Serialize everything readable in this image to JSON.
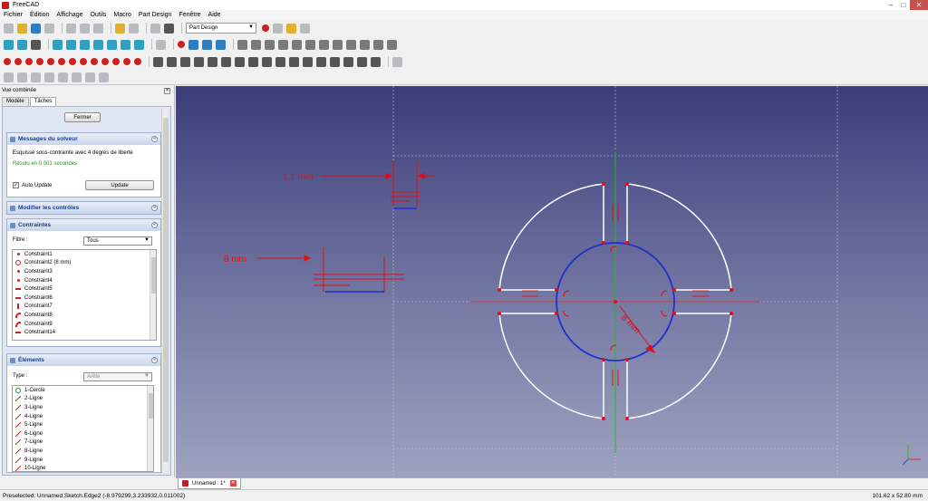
{
  "window": {
    "title": "FreeCAD"
  },
  "menu": [
    "Fichier",
    "Édition",
    "Affichage",
    "Outils",
    "Macro",
    "Part Design",
    "Fenêtre",
    "Aide"
  ],
  "toolbar": {
    "workbench": "Part Design"
  },
  "combo_view": {
    "title": "Vue combinée",
    "tabs": [
      "Modèle",
      "Tâches"
    ],
    "close_button": "Fermer",
    "solver": {
      "title": "Messages du solveur",
      "message": "Esquisse sous-contrainte avec 4 degrés de liberté",
      "status": "Résolu en 0.001 secondes",
      "auto_update_label": "Auto Update",
      "auto_update_checked": true,
      "update_button": "Update"
    },
    "controls": {
      "title": "Modifier les contrôles"
    },
    "constraints": {
      "title": "Contraintes",
      "filter_label": "Filtre :",
      "filter_value": "Tous",
      "items": [
        {
          "label": "Constraint1",
          "icon": "point-on-object-icon"
        },
        {
          "label": "Constraint2 (8 mm)",
          "icon": "radius-icon"
        },
        {
          "label": "Constraint3",
          "icon": "point-on-object-icon"
        },
        {
          "label": "Constraint4",
          "icon": "point-on-object-icon"
        },
        {
          "label": "Constraint5",
          "icon": "horizontal-icon"
        },
        {
          "label": "Constraint6",
          "icon": "horizontal-icon"
        },
        {
          "label": "Constraint7",
          "icon": "vertical-icon"
        },
        {
          "label": "Constraint8",
          "icon": "tangent-icon"
        },
        {
          "label": "Constraint9",
          "icon": "tangent-icon"
        },
        {
          "label": "Constraint14",
          "icon": "horizontal-icon"
        }
      ]
    },
    "elements": {
      "title": "Éléments",
      "type_label": "Type :",
      "type_value": "Arête",
      "items": [
        {
          "label": "1-Cercle",
          "icon": "circle-icon"
        },
        {
          "label": "2-Ligne",
          "icon": "line-icon"
        },
        {
          "label": "3-Ligne",
          "icon": "line-icon"
        },
        {
          "label": "4-Ligne",
          "icon": "line-icon"
        },
        {
          "label": "5-Ligne",
          "icon": "line-icon"
        },
        {
          "label": "6-Ligne",
          "icon": "line-icon"
        },
        {
          "label": "7-Ligne",
          "icon": "line-icon"
        },
        {
          "label": "8-Ligne",
          "icon": "line-icon"
        },
        {
          "label": "9-Ligne",
          "icon": "line-icon"
        },
        {
          "label": "10-Ligne",
          "icon": "line-icon"
        }
      ]
    }
  },
  "sketch": {
    "dim_top": "1,1 mm",
    "dim_left": "8 mm",
    "dim_radius": "8 mm",
    "colors": {
      "geometry": "#ffffff",
      "selected": "#1f2fd0",
      "constraint": "#e01010",
      "axis_v": "#2bb52b",
      "axis_h": "#d04040"
    }
  },
  "document_tab": "Unnamed : 1*",
  "status": {
    "preselected": "Preselected: Unnamed.Sketch.Edge2 (-8.979299,3.233932,0.011002)",
    "dimensions": "101.62 x 52.80 mm"
  }
}
